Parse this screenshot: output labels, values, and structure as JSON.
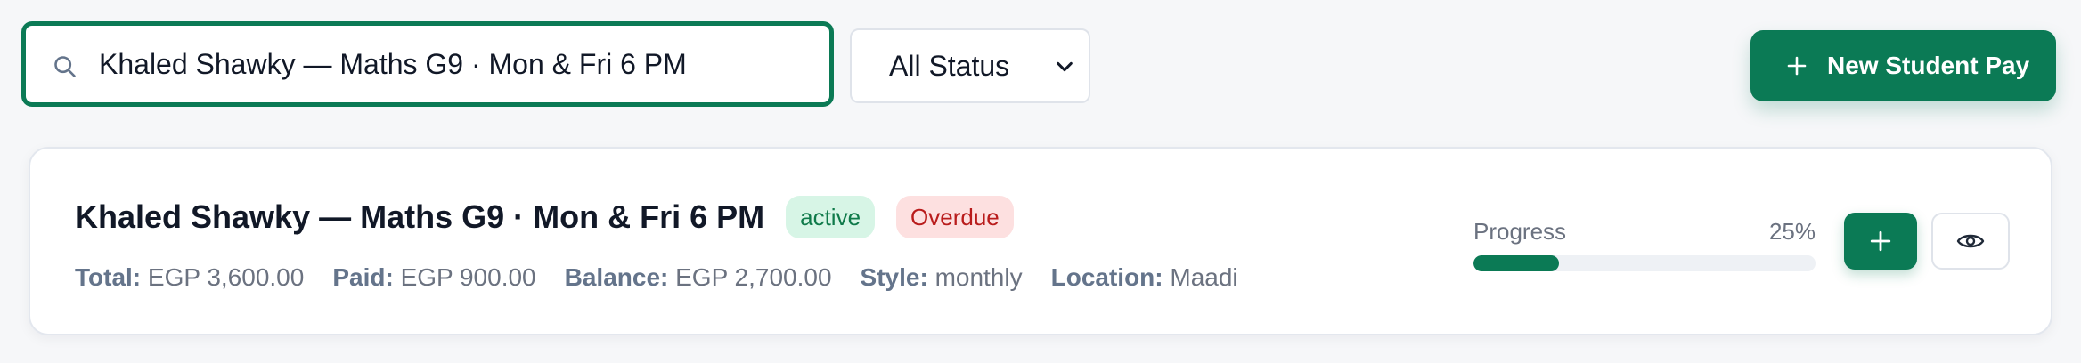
{
  "toolbar": {
    "search": {
      "value": "Khaled Shawky — Maths G9 · Mon & Fri 6 PM",
      "icon": "search-icon"
    },
    "status_filter": {
      "selected": "All Status",
      "icon": "chevron-down-icon"
    },
    "new_button": {
      "label": "New Student Pay",
      "icon": "plus-icon"
    }
  },
  "card": {
    "title": "Khaled Shawky — Maths G9 · Mon & Fri 6 PM",
    "badges": {
      "status": "active",
      "payment": "Overdue"
    },
    "meta": {
      "total_label": "Total:",
      "total_value": "EGP 3,600.00",
      "paid_label": "Paid:",
      "paid_value": "EGP 900.00",
      "balance_label": "Balance:",
      "balance_value": "EGP 2,700.00",
      "style_label": "Style:",
      "style_value": "monthly",
      "location_label": "Location:",
      "location_value": "Maadi"
    },
    "progress": {
      "label": "Progress",
      "percent_text": "25%",
      "value": 25
    },
    "actions": {
      "add_icon": "plus-icon",
      "view_icon": "eye-icon"
    }
  },
  "colors": {
    "accent": "#0b7a55",
    "active_bg": "#d7f5e6",
    "active_text": "#0f7a4a",
    "overdue_bg": "#fde0e0",
    "overdue_text": "#b91c1c"
  }
}
